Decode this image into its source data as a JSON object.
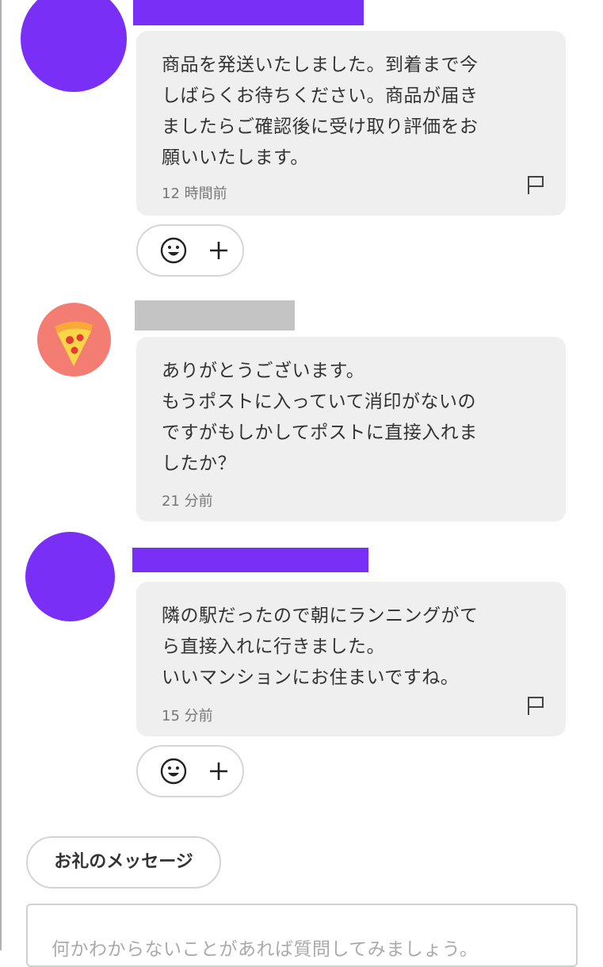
{
  "colors": {
    "accent_purple": "#7a2ff7",
    "bubble_bg": "#efefef",
    "redacted_gray": "#c4c4c4",
    "pizza_avatar_bg": "#f37d73"
  },
  "messages": [
    {
      "text": "商品を発送いたしました。到着まで今\nしばらくお待ちください。商品が届き\nましたらご確認後に受け取り評価をお\n願いいたします。",
      "time": "12 時間前",
      "icons": [
        "flag-icon",
        "smile-icon",
        "plus-icon"
      ]
    },
    {
      "text": "ありがとうございます。\nもうポストに入っていて消印がないの\nですがもしかしてポストに直接入れま\nしたか？",
      "time": "21 分前",
      "icons": [
        "pizza-icon"
      ]
    },
    {
      "text": "隣の駅だったので朝にランニングがて\nら直接入れに行きました。\nいいマンションにお住まいですね。",
      "time": "15 分前",
      "icons": [
        "flag-icon",
        "smile-icon",
        "plus-icon"
      ]
    }
  ],
  "thanks_button": {
    "label": "お礼のメッセージ"
  },
  "comment_input": {
    "placeholder": "何かわからないことがあれば質問してみましょう。"
  }
}
